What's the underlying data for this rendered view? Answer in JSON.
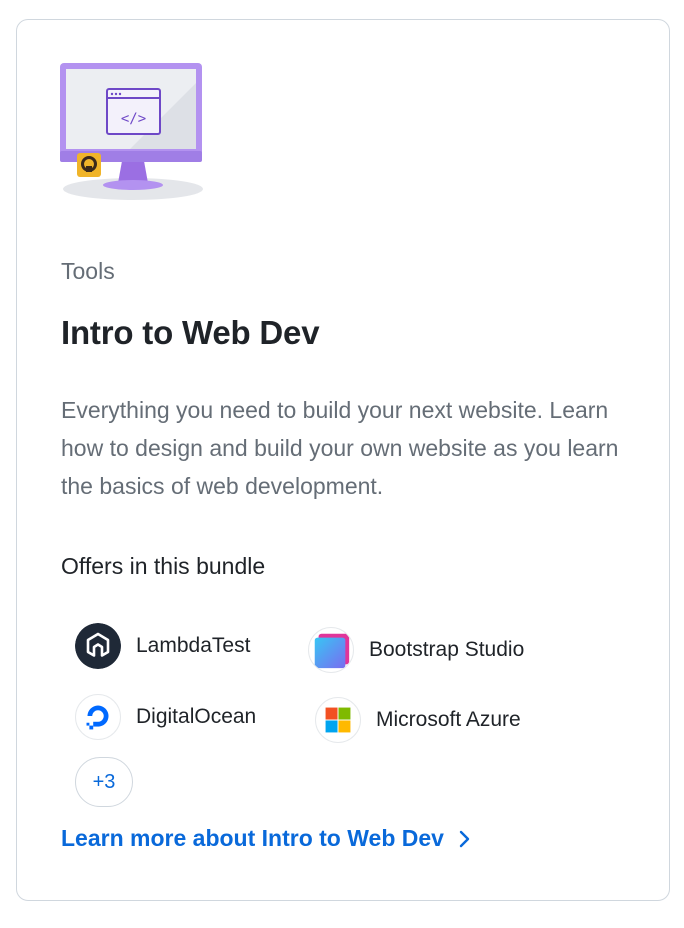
{
  "card": {
    "category": "Tools",
    "title": "Intro to Web Dev",
    "description": "Everything you need to build your next website. Learn how to design and build your own website as you learn the basics of web development.",
    "offers_heading": "Offers in this bundle",
    "offers": [
      {
        "name": "LambdaTest",
        "icon": "lambdatest-logo-icon",
        "color": "#1f2937"
      },
      {
        "name": "Bootstrap Studio",
        "icon": "bootstrap-studio-logo-icon",
        "color": "#7952b3"
      },
      {
        "name": "DigitalOcean",
        "icon": "digitalocean-logo-icon",
        "color": "#0069ff"
      },
      {
        "name": "Microsoft Azure",
        "icon": "microsoft-logo-icon",
        "color": "#f25022"
      }
    ],
    "more_badge": "+3",
    "learn_more_link": "Learn more about Intro to Web Dev",
    "link_color": "#0969da",
    "illustration": {
      "icon": "monitor-code-illustration",
      "accent": "#b392f0"
    }
  }
}
